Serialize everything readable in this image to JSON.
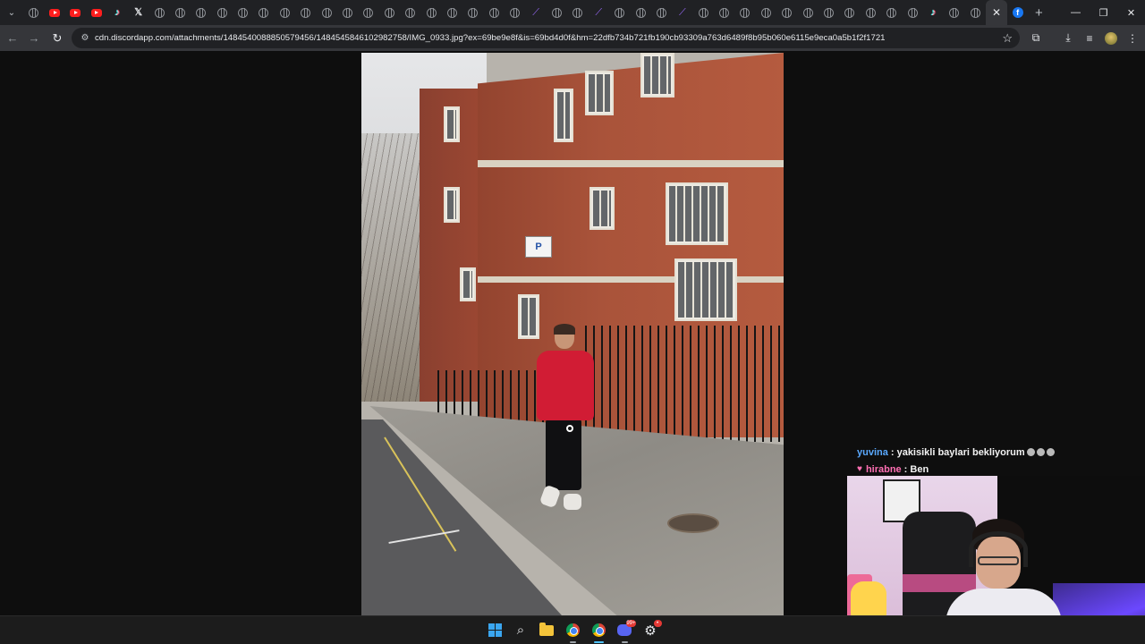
{
  "browser": {
    "tabs": [
      {
        "icon": "globe-icon",
        "kind": "globe"
      },
      {
        "icon": "youtube-icon",
        "kind": "yt"
      },
      {
        "icon": "youtube-icon",
        "kind": "yt"
      },
      {
        "icon": "youtube-icon",
        "kind": "yt"
      },
      {
        "icon": "tiktok-icon",
        "kind": "tiktok"
      },
      {
        "icon": "x-icon",
        "kind": "x"
      },
      {
        "icon": "globe-icon",
        "kind": "globe"
      },
      {
        "icon": "globe-icon",
        "kind": "globe"
      },
      {
        "icon": "globe-icon",
        "kind": "globe"
      },
      {
        "icon": "globe-icon",
        "kind": "globe"
      },
      {
        "icon": "globe-icon",
        "kind": "globe"
      },
      {
        "icon": "globe-icon",
        "kind": "globe"
      },
      {
        "icon": "globe-icon",
        "kind": "globe"
      },
      {
        "icon": "globe-icon",
        "kind": "globe"
      },
      {
        "icon": "globe-icon",
        "kind": "globe"
      },
      {
        "icon": "globe-icon",
        "kind": "globe"
      },
      {
        "icon": "globe-icon",
        "kind": "globe"
      },
      {
        "icon": "globe-icon",
        "kind": "globe"
      },
      {
        "icon": "globe-icon",
        "kind": "globe"
      },
      {
        "icon": "globe-icon",
        "kind": "globe"
      },
      {
        "icon": "globe-icon",
        "kind": "globe"
      },
      {
        "icon": "globe-icon",
        "kind": "globe"
      },
      {
        "icon": "globe-icon",
        "kind": "globe"
      },
      {
        "icon": "globe-icon",
        "kind": "globe"
      },
      {
        "icon": "feather-icon",
        "kind": "feather"
      },
      {
        "icon": "globe-icon",
        "kind": "globe"
      },
      {
        "icon": "globe-icon",
        "kind": "globe"
      },
      {
        "icon": "feather-icon",
        "kind": "feather"
      },
      {
        "icon": "globe-icon",
        "kind": "globe"
      },
      {
        "icon": "globe-icon",
        "kind": "globe"
      },
      {
        "icon": "globe-icon",
        "kind": "globe"
      },
      {
        "icon": "feather-icon",
        "kind": "feather"
      },
      {
        "icon": "globe-icon",
        "kind": "globe"
      },
      {
        "icon": "globe-icon",
        "kind": "globe"
      },
      {
        "icon": "globe-icon",
        "kind": "globe"
      },
      {
        "icon": "globe-icon",
        "kind": "globe"
      },
      {
        "icon": "globe-icon",
        "kind": "globe"
      },
      {
        "icon": "globe-icon",
        "kind": "globe"
      },
      {
        "icon": "globe-icon",
        "kind": "globe"
      },
      {
        "icon": "globe-icon",
        "kind": "globe"
      },
      {
        "icon": "globe-icon",
        "kind": "globe"
      },
      {
        "icon": "globe-icon",
        "kind": "globe"
      },
      {
        "icon": "globe-icon",
        "kind": "globe"
      },
      {
        "icon": "tiktok-icon",
        "kind": "tiktok"
      },
      {
        "icon": "globe-icon",
        "kind": "globe"
      },
      {
        "icon": "globe-icon",
        "kind": "globe"
      },
      {
        "icon": "close-icon",
        "kind": "active"
      },
      {
        "icon": "facebook-icon",
        "kind": "fb"
      }
    ],
    "new_tab_symbol": "+",
    "url": "cdn.discordapp.com/attachments/1484540088850579456/1484545846102982758/IMG_0933.jpg?ex=69be9e8f&is=69bd4d0f&hm=22dfb734b721fb190cb93309a763d6489f8b95b060e6115e9eca0a5b1f2f1721",
    "window_controls": {
      "minimize": "—",
      "restore": "❐",
      "close": "✕"
    },
    "toolbar_icons": {
      "back": "←",
      "forward": "→",
      "reload": "↻",
      "site_info": "⚙",
      "star": "☆",
      "extensions": "⧉",
      "download": "⤓",
      "media": "≡",
      "menu": "⋮"
    }
  },
  "photo": {
    "parking_sign": "P"
  },
  "chat": [
    {
      "name": "yuvina",
      "name_color": "#5aa9ff",
      "message": ": yakisikli baylari bekliyorum",
      "emotes": 3,
      "badge": ""
    },
    {
      "name": "hirabne",
      "name_color": "#ff6fb3",
      "message": ": Ben",
      "emotes": 0,
      "badge": "heart"
    }
  ],
  "taskbar": {
    "items": [
      {
        "name": "start-button",
        "glyph": "windows"
      },
      {
        "name": "search-button",
        "glyph": "search"
      },
      {
        "name": "file-explorer-button",
        "glyph": "folder"
      },
      {
        "name": "chrome-button",
        "glyph": "chrome",
        "running": true
      },
      {
        "name": "chrome-button-2",
        "glyph": "chrome",
        "running": true,
        "active": true
      },
      {
        "name": "discord-button",
        "glyph": "discord",
        "badge": "99+",
        "running": true
      },
      {
        "name": "settings-button",
        "glyph": "gear",
        "badge": "•"
      }
    ],
    "search_symbol": "⌕",
    "gear_symbol": "⚙"
  }
}
